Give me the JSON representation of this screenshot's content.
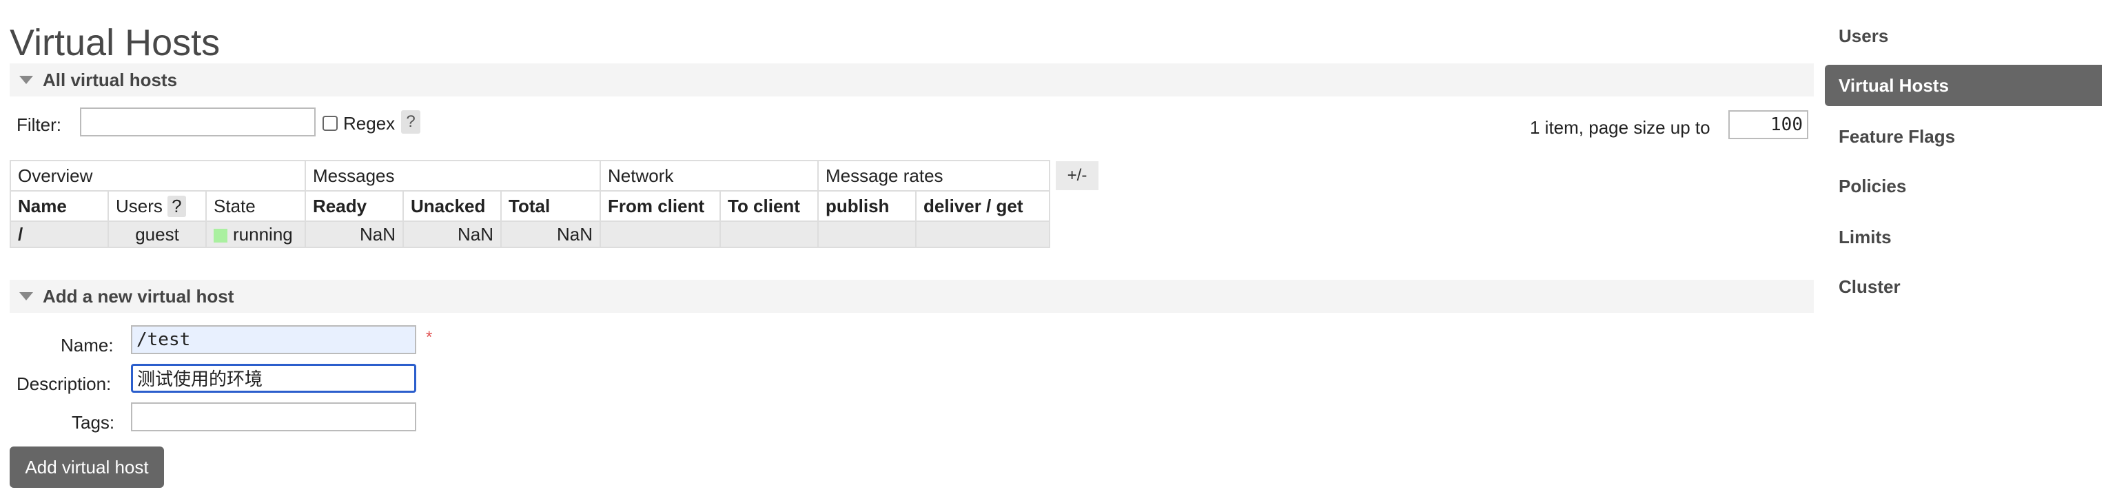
{
  "page": {
    "title": "Virtual Hosts"
  },
  "all_section": {
    "title": "All virtual hosts"
  },
  "filter": {
    "label": "Filter:",
    "value": "",
    "regex_label": "Regex",
    "help": "?"
  },
  "pagination": {
    "summary": "1 item, page size up to",
    "page_size": "100"
  },
  "table": {
    "groups": [
      "Overview",
      "Messages",
      "Network",
      "Message rates"
    ],
    "columns": {
      "name": "Name",
      "users": "Users",
      "users_help": "?",
      "state": "State",
      "ready": "Ready",
      "unacked": "Unacked",
      "total": "Total",
      "from_client": "From client",
      "to_client": "To client",
      "publish": "publish",
      "deliver_get": "deliver / get"
    },
    "rows": [
      {
        "name": "/",
        "users": "guest",
        "state": "running",
        "ready": "NaN",
        "unacked": "NaN",
        "total": "NaN",
        "from_client": "",
        "to_client": "",
        "publish": "",
        "deliver_get": ""
      }
    ],
    "toggle_columns": "+/-"
  },
  "add_section": {
    "title": "Add a new virtual host"
  },
  "form": {
    "name_label": "Name:",
    "name_value": "/test",
    "required_mark": "*",
    "description_label": "Description:",
    "description_value": "测试使用的环境",
    "tags_label": "Tags:",
    "tags_value": "",
    "submit": "Add virtual host"
  },
  "sidebar": {
    "items": [
      {
        "label": "Users",
        "active": false
      },
      {
        "label": "Virtual Hosts",
        "active": true
      },
      {
        "label": "Feature Flags",
        "active": false
      },
      {
        "label": "Policies",
        "active": false
      },
      {
        "label": "Limits",
        "active": false
      },
      {
        "label": "Cluster",
        "active": false
      }
    ]
  },
  "colors": {
    "active_nav_bg": "#666666",
    "running_state": "#aaf0a0",
    "section_bg": "#f4f4f4"
  }
}
